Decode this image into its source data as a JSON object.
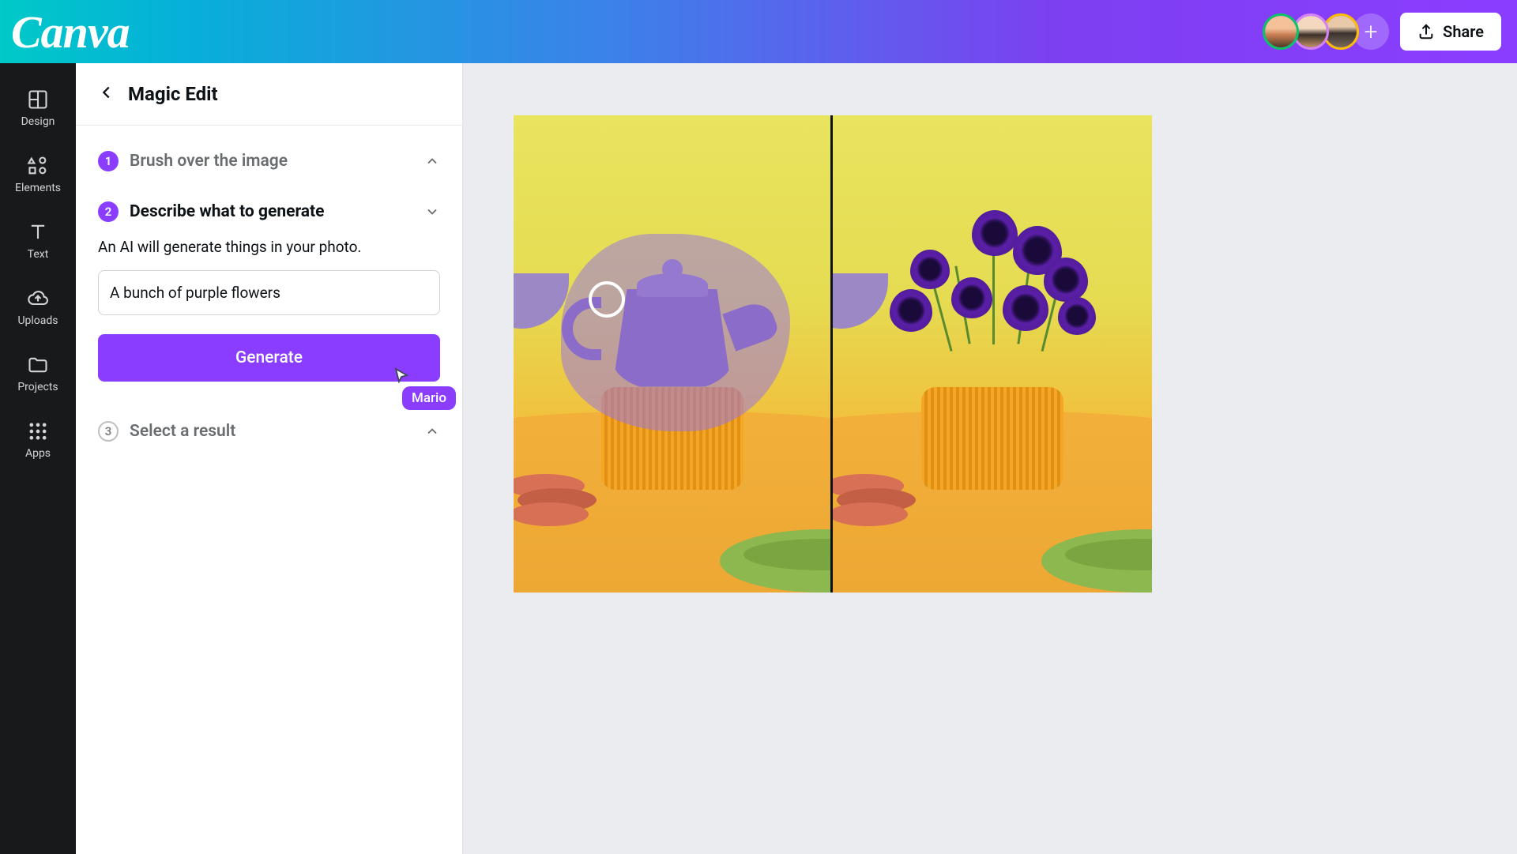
{
  "header": {
    "logo": "Canva",
    "share_label": "Share"
  },
  "sidebar": {
    "items": [
      {
        "label": "Design",
        "icon": "layout-icon"
      },
      {
        "label": "Elements",
        "icon": "shapes-icon"
      },
      {
        "label": "Text",
        "icon": "text-icon"
      },
      {
        "label": "Uploads",
        "icon": "cloud-upload-icon"
      },
      {
        "label": "Projects",
        "icon": "folder-icon"
      },
      {
        "label": "Apps",
        "icon": "apps-grid-icon"
      }
    ]
  },
  "panel": {
    "title": "Magic Edit",
    "steps": [
      {
        "num": "1",
        "label": "Brush over the image"
      },
      {
        "num": "2",
        "label": "Describe what to generate"
      },
      {
        "num": "3",
        "label": "Select a result"
      }
    ],
    "description": "An AI will generate things in your photo.",
    "prompt_value": "A bunch of purple flowers",
    "generate_label": "Generate",
    "cursor_user": "Mario"
  }
}
